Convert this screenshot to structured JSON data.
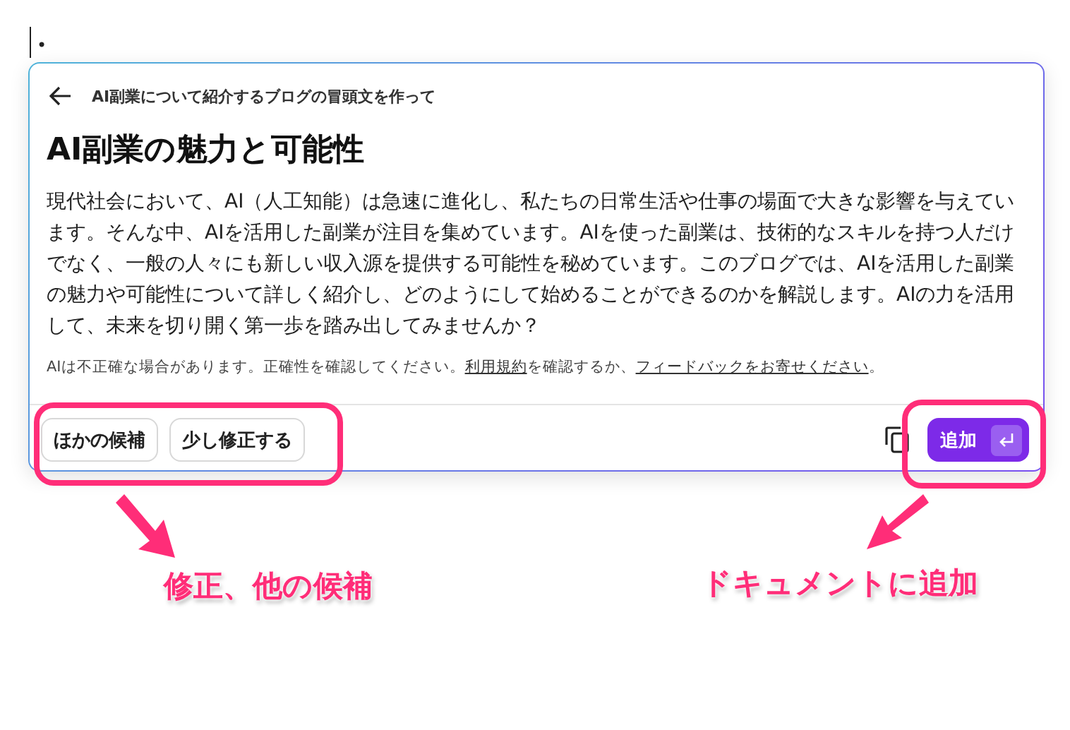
{
  "editor": {
    "bullet": "•"
  },
  "panel": {
    "prompt": "AI副業について紹介するブログの冒頭文を作って",
    "title": "AI副業の魅力と可能性",
    "body": "現代社会において、AI（人工知能）は急速に進化し、私たちの日常生活や仕事の場面で大きな影響を与えています。そんな中、AIを活用した副業が注目を集めています。AIを使った副業は、技術的なスキルを持つ人だけでなく、一般の人々にも新しい収入源を提供する可能性を秘めています。このブログでは、AIを活用した副業の魅力や可能性について詳しく紹介し、どのようにして始めることができるのかを解説します。AIの力を活用して、未来を切り開く第一歩を踏み出してみませんか？",
    "disclaimer": [
      {
        "kind": "text",
        "text": "AIは不正確な場合があります。正確性を確認してください。"
      },
      {
        "kind": "link",
        "text": "利用規約"
      },
      {
        "kind": "text",
        "text": "を確認するか、"
      },
      {
        "kind": "link",
        "text": "フィードバックをお寄せください"
      },
      {
        "kind": "text",
        "text": "。"
      }
    ],
    "actions": [
      "ほかの候補",
      "少し修正する"
    ],
    "add_button": {
      "label": "追加"
    }
  },
  "annotations": [
    "修正、他の候補",
    "ドキュメントに追加"
  ]
}
